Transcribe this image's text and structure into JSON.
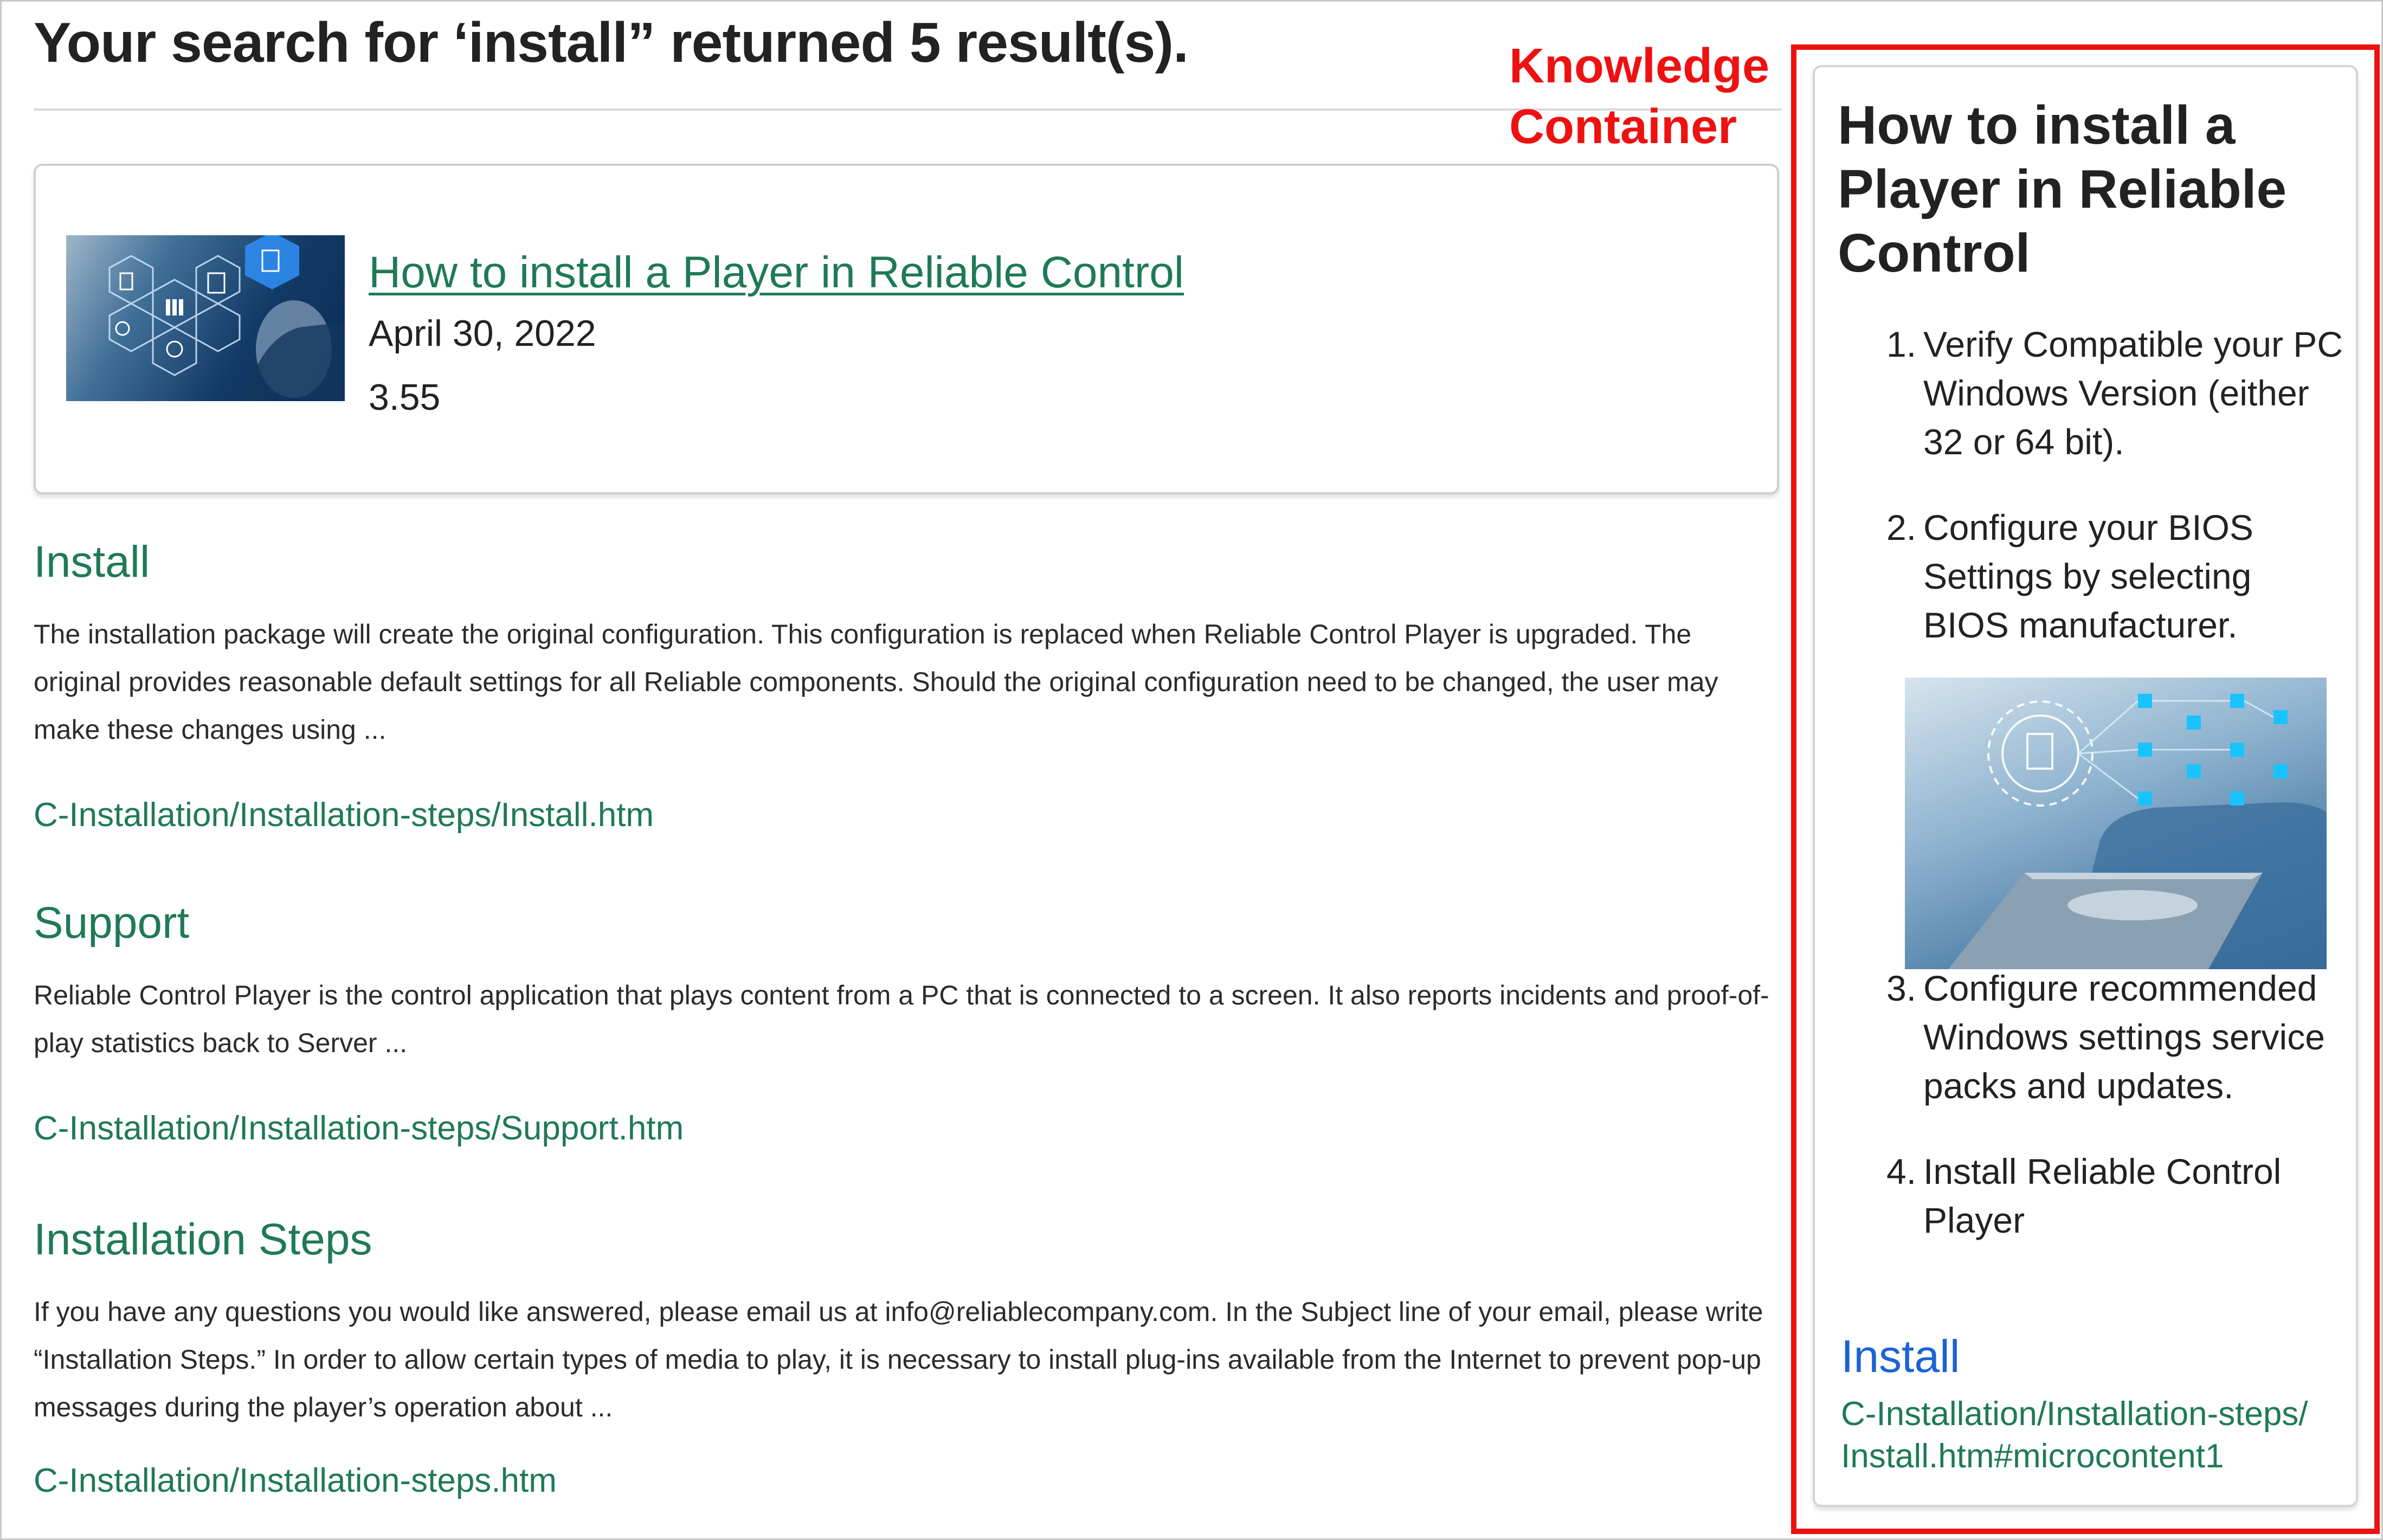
{
  "search": {
    "headline": "Your search for ‘install” returned 5 result(s)."
  },
  "top_result": {
    "title": "How to install a Player in Reliable Control",
    "date": "April 30, 2022",
    "score": "3.55",
    "thumbnail_icon": "digital-documents-hexagon-image"
  },
  "results": [
    {
      "title": "Install",
      "snippet": "The installation package will create the original configuration. This configuration is replaced when Reliable Control Player is upgraded. The original provides reasonable default settings for all Reliable components. Should the original configuration need to be changed, the user may make these changes using ...",
      "url": "C-Installation/Installation-steps/Install.htm"
    },
    {
      "title": "Support",
      "snippet": "Reliable Control Player is the control application that plays content from a PC that is connected to a screen. It also reports incidents and proof-of-play statistics back to Server ...",
      "url": "C-Installation/Installation-steps/Support.htm"
    },
    {
      "title": "Installation Steps",
      "snippet": "If you have any questions you would like answered, please email us at info@reliablecompany.com. In the Subject line of your email, please write “Installation Steps.”  In order to allow certain types of media to play, it is necessary to install plug-ins available from the Internet to prevent pop-up messages during the player’s operation about ...",
      "url": "C-Installation/Installation-steps.htm"
    }
  ],
  "annotation": {
    "label_line1": "Knowledge",
    "label_line2": "Container"
  },
  "knowledge": {
    "title": "How to install a Player in Reliable Control",
    "steps": [
      {
        "num": "1.",
        "text": "Verify Compatible your PC Windows Version (either 32 or 64 bit)."
      },
      {
        "num": "2.",
        "text": "Configure your BIOS Settings by selecting BIOS manufacturer."
      },
      {
        "num": "3.",
        "text": "Configure recommended Windows settings service packs and updates."
      },
      {
        "num": "4.",
        "text": "Install Reliable Control Player"
      }
    ],
    "image_icon": "laptop-data-network-image",
    "link_title": "Install",
    "link_url": "C-Installation/Installation-steps/ Install.htm#microcontent1"
  },
  "colors": {
    "link_green": "#1f7a55",
    "link_blue": "#1a63d6",
    "annotation_red": "#ee1111"
  }
}
